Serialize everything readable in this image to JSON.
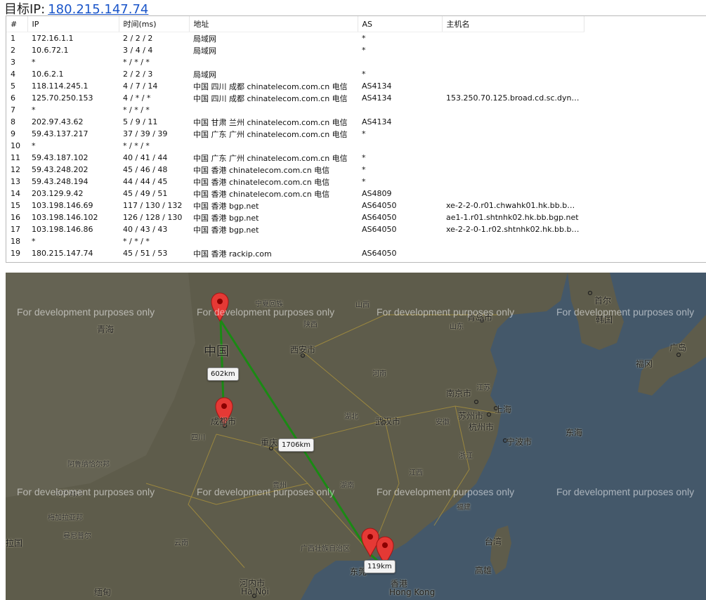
{
  "header": {
    "label": "目标IP:",
    "target_ip": "180.215.147.74"
  },
  "table": {
    "columns": [
      "#",
      "IP",
      "时间(ms)",
      "地址",
      "AS",
      "主机名"
    ],
    "rows": [
      [
        "1",
        "172.16.1.1",
        "2 / 2 / 2",
        "局域网",
        "*",
        ""
      ],
      [
        "2",
        "10.6.72.1",
        "3 / 4 / 4",
        "局域网",
        "*",
        ""
      ],
      [
        "3",
        "*",
        "* / * / *",
        "",
        "",
        ""
      ],
      [
        "4",
        "10.6.2.1",
        "2 / 2 / 3",
        "局域网",
        "*",
        ""
      ],
      [
        "5",
        "118.114.245.1",
        "4 / 7 / 14",
        "中国 四川 成都 chinatelecom.com.cn 电信",
        "AS4134",
        ""
      ],
      [
        "6",
        "125.70.250.153",
        "4 / * / *",
        "中国 四川 成都 chinatelecom.com.cn 电信",
        "AS4134",
        "153.250.70.125.broad.cd.sc.dynam..."
      ],
      [
        "7",
        "*",
        "* / * / *",
        "",
        "",
        ""
      ],
      [
        "8",
        "202.97.43.62",
        "5 / 9 / 11",
        "中国 甘肃 兰州 chinatelecom.com.cn 电信",
        "AS4134",
        ""
      ],
      [
        "9",
        "59.43.137.217",
        "37 / 39 / 39",
        "中国 广东 广州 chinatelecom.com.cn 电信",
        "*",
        ""
      ],
      [
        "10",
        "*",
        "* / * / *",
        "",
        "",
        ""
      ],
      [
        "11",
        "59.43.187.102",
        "40 / 41 / 44",
        "中国 广东 广州 chinatelecom.com.cn 电信",
        "*",
        ""
      ],
      [
        "12",
        "59.43.248.202",
        "45 / 46 / 48",
        "中国 香港 chinatelecom.com.cn 电信",
        "*",
        ""
      ],
      [
        "13",
        "59.43.248.194",
        "44 / 44 / 45",
        "中国 香港 chinatelecom.com.cn 电信",
        "*",
        ""
      ],
      [
        "14",
        "203.129.9.42",
        "45 / 49 / 51",
        "中国 香港 chinatelecom.com.cn 电信",
        "AS4809",
        ""
      ],
      [
        "15",
        "103.198.146.69",
        "117 / 130 / 132",
        "中国 香港 bgp.net",
        "AS64050",
        "xe-2-2-0.r01.chwahk01.hk.bb.bgp.net"
      ],
      [
        "16",
        "103.198.146.102",
        "126 / 128 / 130",
        "中国 香港 bgp.net",
        "AS64050",
        "ae1-1.r01.shtnhk02.hk.bb.bgp.net"
      ],
      [
        "17",
        "103.198.146.86",
        "40 / 43 / 43",
        "中国 香港 bgp.net",
        "AS64050",
        "xe-2-2-0-1.r02.shtnhk02.hk.bb.bgp..."
      ],
      [
        "18",
        "*",
        "* / * / *",
        "",
        "",
        ""
      ],
      [
        "19",
        "180.215.147.74",
        "45 / 51 / 53",
        "中国 香港 rackip.com",
        "AS64050",
        ""
      ]
    ]
  },
  "map": {
    "watermark": "For development purposes only",
    "distances": [
      "602km",
      "1706km",
      "119km"
    ],
    "places": [
      {
        "name": "中国",
        "size": "big"
      },
      {
        "name": "西安市"
      },
      {
        "name": "成都市"
      },
      {
        "name": "重庆"
      },
      {
        "name": "武汉市"
      },
      {
        "name": "南京市"
      },
      {
        "name": "苏州市"
      },
      {
        "name": "上海"
      },
      {
        "name": "杭州市"
      },
      {
        "name": "宁波市"
      },
      {
        "name": "青岛市"
      },
      {
        "name": "首尔"
      },
      {
        "name": "韩国"
      },
      {
        "name": "福冈"
      },
      {
        "name": "广岛"
      },
      {
        "name": "台湾"
      },
      {
        "name": "高雄"
      },
      {
        "name": "香港"
      },
      {
        "name": "Hong Kong"
      },
      {
        "name": "东莞"
      },
      {
        "name": "河内市"
      },
      {
        "name": "Hà Nội"
      },
      {
        "name": "缅甸"
      },
      {
        "name": "拉国"
      },
      {
        "name": "青海"
      },
      {
        "name": "山西"
      },
      {
        "name": "陕西"
      },
      {
        "name": "河南"
      },
      {
        "name": "湖北"
      },
      {
        "name": "湖南"
      },
      {
        "name": "贵州"
      },
      {
        "name": "云南"
      },
      {
        "name": "四川"
      },
      {
        "name": "宁夏回族"
      },
      {
        "name": "山东"
      },
      {
        "name": "江苏"
      },
      {
        "name": "安徽"
      },
      {
        "name": "浙江"
      },
      {
        "name": "江西"
      },
      {
        "name": "福建"
      },
      {
        "name": "广西壮族自治区"
      },
      {
        "name": "东海"
      },
      {
        "name": "阿鲁纳恰尔邦"
      },
      {
        "name": "阿萨姆邦"
      },
      {
        "name": "梅加拉亚邦"
      },
      {
        "name": "曼尼普尔"
      }
    ]
  }
}
